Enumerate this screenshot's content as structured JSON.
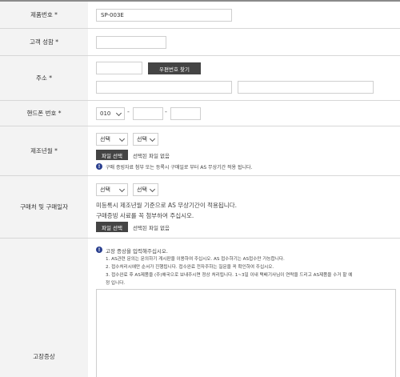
{
  "product": {
    "label": "제품번호 *",
    "value": "SP-003E"
  },
  "customer_name": {
    "label": "고객 성함 *",
    "value": ""
  },
  "address": {
    "label": "주소 *",
    "postcode_button": "우편번호 찾기"
  },
  "phone": {
    "label": "핸드폰 번호 *",
    "prefix": "010",
    "dash": "-"
  },
  "manufacture": {
    "label": "제조년월 *",
    "year_select": "선택",
    "month_select": "선택",
    "file_button": "파일 선택",
    "file_status": "선택된 파일 없음",
    "notice": "구매 증빙자료 첨부 또는 등록시 구매일로 부터 AS 무상기간 적용 됩니다."
  },
  "purchase": {
    "label": "구매처 및 구매일자",
    "year_select": "선택",
    "month_select": "선택",
    "line1": "미등록시 제조년월 기준으로 AS 무상기간이 적용됩니다.",
    "line2": "구매증빙 사료를 꼭 첨부하여 주십시오.",
    "file_button": "파일 선택",
    "file_status": "선택된 파일 없음"
  },
  "symptom": {
    "label": "고장증상",
    "notice_title": "고장 증상을 입력해주십시오.",
    "notes": [
      "1. AS관련 문의는 문의하기 게시판을 이용하여 주십시오. AS 접수하기는 AS접수만 가능합니다.",
      "2. 접수처리시에만 순서가 진행됩니다. 접수완료 전자주하는 질문을 꼭 확인하여 주십시오.",
      "3. 접수완료 후 AS제품을 (주)해국으로 보내주시면 정상 처리됩니다. 1~3일 이내 택배기사님이 연락을 드리고 AS제품을 수거 할 예",
      "정 입니다."
    ]
  }
}
